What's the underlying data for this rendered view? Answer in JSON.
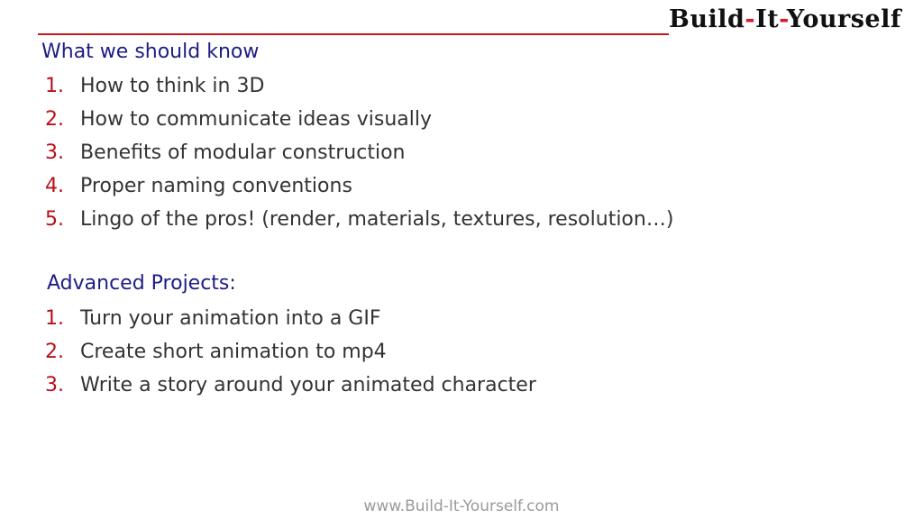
{
  "logo": {
    "text_parts": [
      "Build",
      "It",
      "Yourself"
    ]
  },
  "section1": {
    "heading": "What we should know",
    "items": [
      {
        "num": "1.",
        "text": "How to think in 3D"
      },
      {
        "num": "2.",
        "text": "How to communicate ideas visually"
      },
      {
        "num": "3.",
        "text": "Benefits of modular construction"
      },
      {
        "num": "4.",
        "text": "Proper naming conventions"
      },
      {
        "num": "5.",
        "text": "Lingo of the pros! (render, materials, textures, resolution…)"
      }
    ]
  },
  "section2": {
    "heading": "Advanced Projects:",
    "items": [
      {
        "num": "1.",
        "text": "Turn your animation into a GIF"
      },
      {
        "num": "2.",
        "text": "Create short animation to mp4"
      },
      {
        "num": "3.",
        "text": "Write a story around your animated character"
      }
    ]
  },
  "footer": {
    "url": "www.Build-It-Yourself.com"
  }
}
